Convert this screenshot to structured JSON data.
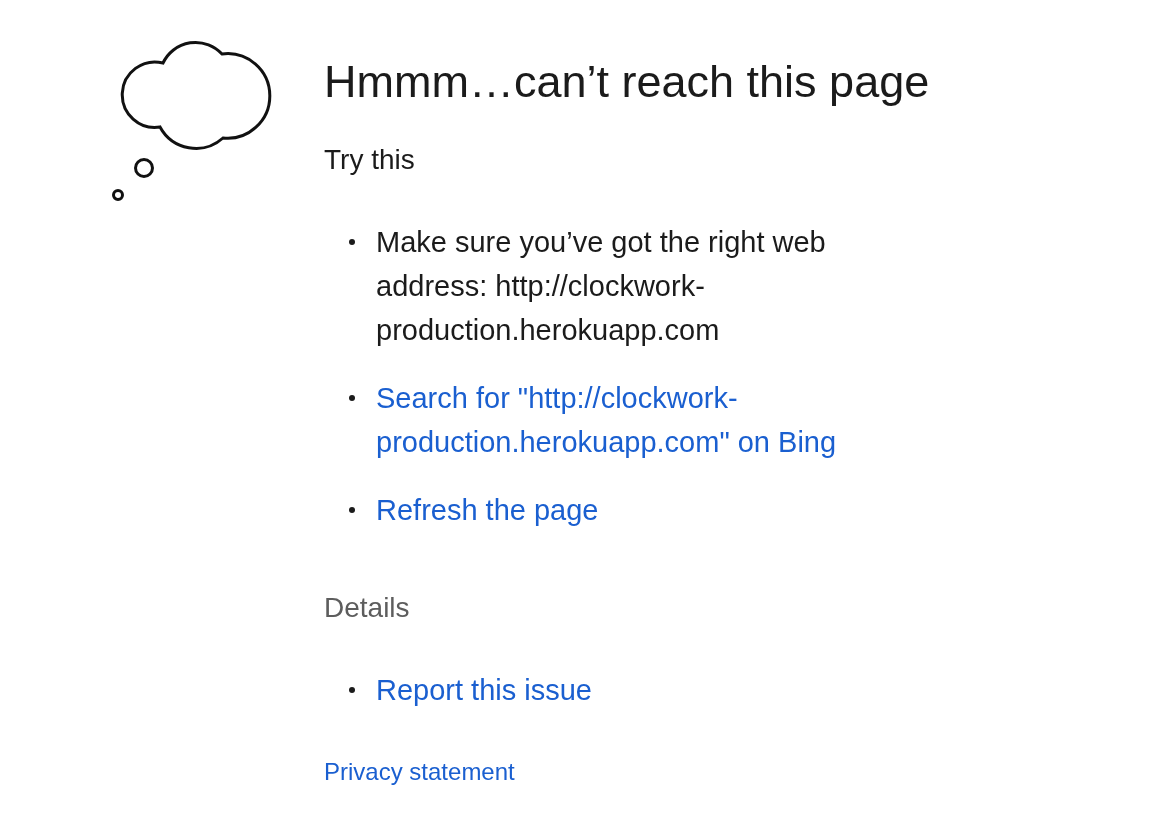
{
  "error_page": {
    "title": "Hmmm…can’t reach this page",
    "suggestions_heading": "Try this",
    "suggestions": [
      {
        "kind": "text",
        "text": "Make sure you’ve got the right web address: http://clockwork-production.herokuapp.com"
      },
      {
        "kind": "link",
        "text": "Search for \"http://clockwork-production.herokuapp.com\" on Bing"
      },
      {
        "kind": "link",
        "text": "Refresh the page"
      }
    ],
    "details_heading": "Details",
    "details": [
      {
        "kind": "link",
        "text": "Report this issue"
      }
    ],
    "privacy_link": "Privacy statement"
  }
}
